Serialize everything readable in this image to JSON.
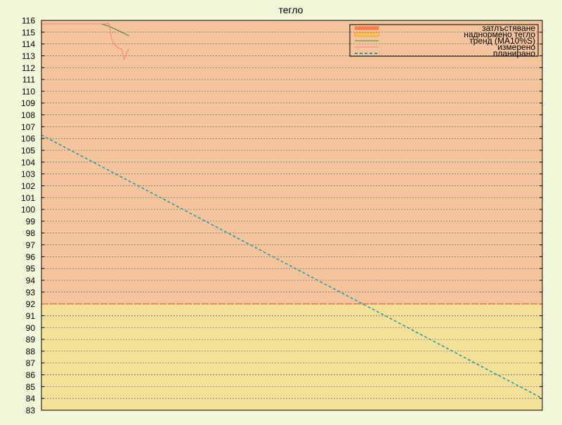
{
  "chart_data": {
    "type": "line",
    "title": "тегло",
    "xlabel": "",
    "ylabel": "",
    "ylim": [
      83,
      116
    ],
    "y_ticks": [
      83,
      84,
      85,
      86,
      87,
      88,
      89,
      90,
      91,
      92,
      93,
      94,
      95,
      96,
      97,
      98,
      99,
      100,
      101,
      102,
      103,
      104,
      105,
      106,
      107,
      108,
      109,
      110,
      111,
      112,
      113,
      114,
      115,
      116
    ],
    "xlim": [
      0,
      100
    ],
    "grid": true,
    "grid_style": "horizontal dotted",
    "legend_position": "top-right",
    "bands": [
      {
        "name": "затлъстяване",
        "from": 92,
        "to": 116,
        "color": "#f4c59c"
      },
      {
        "name": "наднормено тегло",
        "from": 83,
        "to": 92,
        "color": "#f3e19a"
      }
    ],
    "threshold_line": {
      "value": 92,
      "color": "#ee6633"
    },
    "series": [
      {
        "name": "затлъстяване",
        "kind": "band",
        "color": "#f47c5a"
      },
      {
        "name": "наднормено тегло",
        "kind": "band",
        "color": "#f6c65b"
      },
      {
        "name": "тренд (MA10%S)",
        "kind": "line",
        "color": "#3a8a3a",
        "x": [
          0,
          12,
          13.5,
          15,
          16.5,
          17.5
        ],
        "y": [
          115.7,
          115.7,
          115.5,
          115.2,
          114.9,
          114.7
        ]
      },
      {
        "name": "измерено",
        "kind": "line",
        "color": "#ff7f6e",
        "x": [
          0,
          13.5,
          14,
          14.5,
          15.5,
          16,
          16.5,
          17,
          17.5
        ],
        "y": [
          115.7,
          115.7,
          114.4,
          114.0,
          113.6,
          113.6,
          112.7,
          113.2,
          113.6
        ]
      },
      {
        "name": "планирано",
        "kind": "dashed",
        "color": "#2a9d9d",
        "x": [
          0,
          100
        ],
        "y": [
          106.3,
          84.0
        ]
      }
    ]
  }
}
